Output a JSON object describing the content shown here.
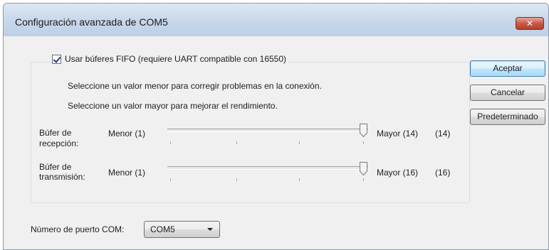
{
  "window": {
    "title": "Configuración avanzada de COM5",
    "close_glyph": "✕",
    "close_icon": "close-icon"
  },
  "fifo": {
    "checkbox_label": "Usar búferes FIFO (requiere UART compatible con 16550)",
    "checked": true,
    "hint_lower": "Seleccione un valor menor para corregir problemas en la conexión.",
    "hint_higher": "Seleccione un valor mayor para mejorar el rendimiento."
  },
  "receive_buffer": {
    "label_line1": "Búfer de",
    "label_line2": "recepción:",
    "min_label": "Menor (1)",
    "max_label": "Mayor (14)",
    "value_display": "(14)",
    "value": 14,
    "min": 1,
    "max": 14
  },
  "transmit_buffer": {
    "label_line1": "Búfer de",
    "label_line2": "transmisión:",
    "min_label": "Menor (1)",
    "max_label": "Mayor (16)",
    "value_display": "(16)",
    "value": 16,
    "min": 1,
    "max": 16
  },
  "com_port": {
    "label": "Número de puerto COM:",
    "selected": "COM5"
  },
  "buttons": {
    "accept": "Aceptar",
    "cancel": "Cancelar",
    "defaults": "Predeterminado"
  },
  "colors": {
    "title_bar": "#c7d7ea",
    "close_button": "#c75a46",
    "dialog_bg": "#f0f0f0",
    "default_button_border": "#3c7fb1"
  }
}
